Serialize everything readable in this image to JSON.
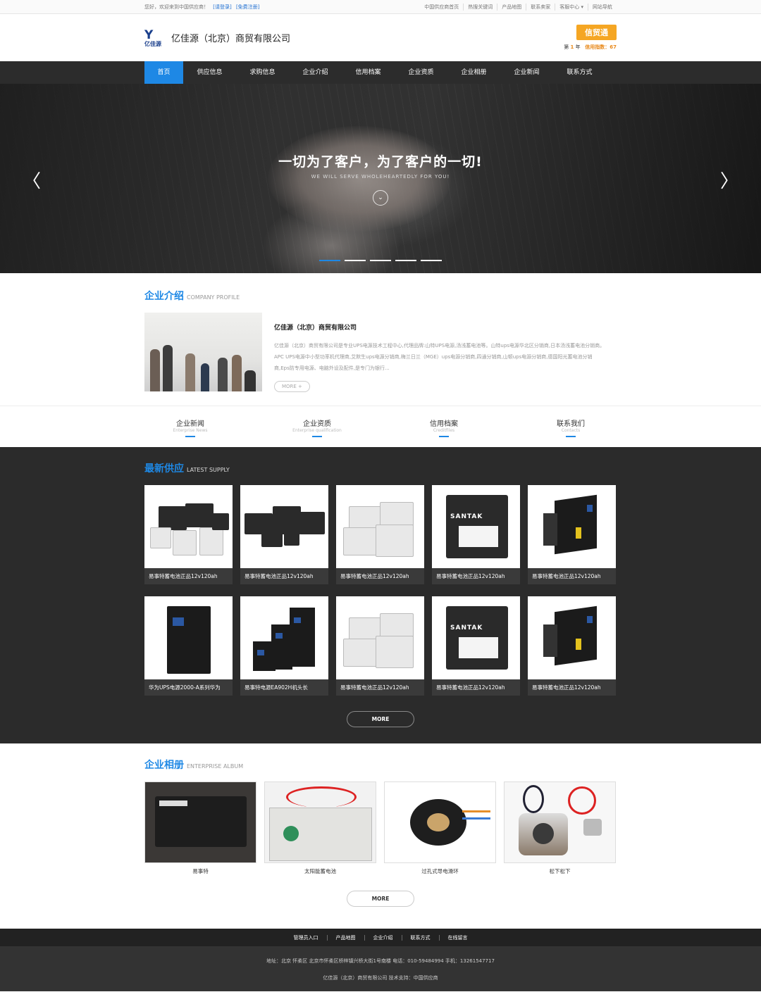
{
  "topbar": {
    "welcome": "您好，欢迎来到中国供应商！",
    "login": "[请登录]",
    "register": "[免费注册]",
    "links": [
      "中国供应商首页",
      "热搜关键词",
      "产品地图",
      "联系卖家",
      "客服中心 ▾",
      "网站导航"
    ]
  },
  "header": {
    "logo_mark": "Y",
    "logo_sub": "亿佳源",
    "company": "亿佳源（北京）商贸有限公司",
    "badge": "信贸通",
    "year_prefix": "第",
    "year_num": "1",
    "year_suffix": "年",
    "credit_label": "信用指数：",
    "credit_value": "67"
  },
  "nav": [
    "首页",
    "供应信息",
    "求购信息",
    "企业介绍",
    "信用档案",
    "企业资质",
    "企业相册",
    "企业新闻",
    "联系方式"
  ],
  "banner": {
    "title": "一切为了客户，为了客户的一切!",
    "subtitle": "WE WILL SERVE WHOLEHEARTEDLY FOR YOU!",
    "circle": "⌄",
    "prev": "〈",
    "next": "〉"
  },
  "profile": {
    "title_cn": "企业介绍",
    "title_en": "COMPANY PROFILE",
    "name": "亿佳源（北京）商贸有限公司",
    "desc": "亿佳源（北京）商贸有限公司是专业UPS电源技术工程中心,代理品牌:山特UPS电源,汤浅蓄电池等。山特ups电源华北区分销商,日本汤浅蓄电池分销商。 APC UPS电源中小型功率机代理商,艾默生ups电源分销商,梅兰日兰（MGE）ups电源分销商,四通分销商,山顿ups电源分销商,德国阳光蓄电池分销商,Eps防专用电源、电脑外设及配件,是专门为银行...",
    "more": "MORE +"
  },
  "quick": [
    {
      "cn": "企业新闻",
      "en": "Enterprise News"
    },
    {
      "cn": "企业资质",
      "en": "Enterprise qualification"
    },
    {
      "cn": "信用档案",
      "en": "Creditfiles"
    },
    {
      "cn": "联系我们",
      "en": "Contacts"
    }
  ],
  "supply": {
    "title_cn": "最新供应",
    "title_en": "LATEST SUPPLY",
    "items": [
      "易事特蓄电池正品12v120ah",
      "易事特蓄电池正品12v120ah",
      "易事特蓄电池正品12v120ah",
      "易事特蓄电池正品12v120ah",
      "易事特蓄电池正品12v120ah",
      "华为UPS电源2000-A系列华为",
      "易事特电源EA902H机头长",
      "易事特蓄电池正品12v120ah",
      "易事特蓄电池正品12v120ah",
      "易事特蓄电池正品12v120ah"
    ],
    "brand_label": "SANTAK",
    "more": "MORE"
  },
  "album": {
    "title_cn": "企业相册",
    "title_en": "ENTERPRISE ALBUM",
    "items": [
      "易事特",
      "太阳能蓄电池",
      "过孔式导电滑环",
      "松下松下"
    ],
    "more": "MORE"
  },
  "footer": {
    "links": [
      "管理员入口",
      "产品地图",
      "企业介绍",
      "联系方式",
      "在线留言"
    ],
    "address": "地址：北京 怀柔区 北京市怀柔区桥梓镇兴桥大街1号南楼 电话：010-59484994 手机：13261547717",
    "copyright": "亿佳源（北京）商贸有限公司 技术支持：中国供应商"
  },
  "colors": {
    "accent": "#1e88e5",
    "badge": "#f5a623",
    "nav_bg": "#2c2c2c",
    "dark_bg": "#2b2b2b"
  }
}
